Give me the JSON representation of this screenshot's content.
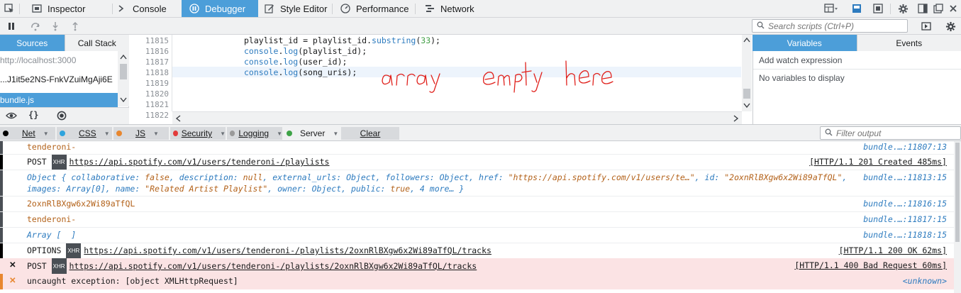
{
  "toolbar": {
    "tabs": [
      {
        "label": "Inspector",
        "icon": "inspector-icon"
      },
      {
        "label": "Console",
        "icon": "console-icon"
      },
      {
        "label": "Debugger",
        "icon": "debugger-icon",
        "selected": true
      },
      {
        "label": "Style Editor",
        "icon": "style-editor-icon"
      },
      {
        "label": "Performance",
        "icon": "performance-icon"
      },
      {
        "label": "Network",
        "icon": "network-icon"
      }
    ],
    "right_icons": [
      "responsive-design-icon",
      "scratchpad-icon",
      "split-console-icon",
      "settings-icon",
      "dock-side-icon",
      "undock-icon",
      "close-icon"
    ]
  },
  "debugger": {
    "search_placeholder": "Search scripts (Ctrl+P)"
  },
  "sources": {
    "tabs": [
      "Sources",
      "Call Stack"
    ],
    "host": "http://localhost:3000",
    "folder": "...J1it5e2NS-FnkVZuiMgAji6E",
    "file": "bundle.js"
  },
  "editor": {
    "lines": [
      {
        "num": "11815",
        "text": "playlist_id = playlist_id.substring(33);"
      },
      {
        "num": "11816",
        "text": "console.log(playlist_id);"
      },
      {
        "num": "11817",
        "text": "console.log(user_id);"
      },
      {
        "num": "11818",
        "text": "console.log(song_uris);",
        "highlighted": true
      },
      {
        "num": "11819",
        "text": ""
      },
      {
        "num": "11820",
        "text": ""
      },
      {
        "num": "11821",
        "text": ""
      },
      {
        "num": "11822",
        "text": ""
      }
    ],
    "annotation": "array empty here",
    "annotation_color": "#e0201b"
  },
  "variables": {
    "tabs": [
      "Variables",
      "Events"
    ],
    "watch": "Add watch expression",
    "empty": "No variables to display"
  },
  "filters": {
    "items": [
      {
        "label": "Net",
        "dot": "#000000"
      },
      {
        "label": "CSS",
        "dot": "#2fa4dd"
      },
      {
        "label": "JS",
        "dot": "#e8872f"
      },
      {
        "label": "Security",
        "dot": "#e23b3b"
      },
      {
        "label": "Logging",
        "dot": "#9a9a9a"
      },
      {
        "label": "Server",
        "dot": "#3ea347"
      }
    ],
    "clear": "Clear",
    "filter_placeholder": "Filter output"
  },
  "console": {
    "rows": [
      {
        "kind": "log",
        "text": "tenderoni-",
        "loc": "bundle.…:11807:13"
      },
      {
        "kind": "net",
        "method": "POST",
        "url": "https://api.spotify.com/v1/users/tenderoni-/playlists",
        "status": "[HTTP/1.1 201 Created 485ms]"
      },
      {
        "kind": "obj",
        "line1": "Object { collaborative: false, description: null, external_urls: Object, followers: Object, href: \"https://api.spotify.com/v1/users/te…\", id: \"2oxnRlBXgw6x2Wi89aTfQL\",",
        "line2": "images: Array[0], name: \"Related Artist Playlist\", owner: Object, public: true, 4 more… }",
        "loc": "bundle.…:11813:15"
      },
      {
        "kind": "log",
        "text": "2oxnRlBXgw6x2Wi89aTfQL",
        "loc": "bundle.…:11816:15"
      },
      {
        "kind": "log",
        "text": "tenderoni-",
        "loc": "bundle.…:11817:15"
      },
      {
        "kind": "arr",
        "text": "Array [  ]",
        "loc": "bundle.…:11818:15"
      },
      {
        "kind": "net",
        "method": "OPTIONS",
        "url": "https://api.spotify.com/v1/users/tenderoni-/playlists/2oxnRlBXgw6x2Wi89aTfQL/tracks",
        "status": "[HTTP/1.1 200 OK 62ms]"
      },
      {
        "kind": "neterr",
        "method": "POST",
        "url": "https://api.spotify.com/v1/users/tenderoni-/playlists/2oxnRlBXgw6x2Wi89aTfQL/tracks",
        "status": "[HTTP/1.1 400 Bad Request 60ms]"
      },
      {
        "kind": "err",
        "text": "uncaught exception: [object XMLHttpRequest]",
        "loc": "<unknown>"
      }
    ],
    "xhr_badge": "XHR"
  }
}
